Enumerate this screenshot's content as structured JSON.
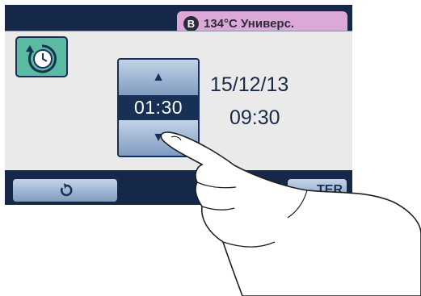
{
  "header": {
    "program_letter": "B",
    "program_label": "134°C Универс."
  },
  "timer": {
    "icon": "timer-clock-icon",
    "up_icon": "▲",
    "down_icon": "▼",
    "value": "01:30"
  },
  "datetime": {
    "date": "15/12/13",
    "time": "09:30"
  },
  "footer": {
    "back_icon": "back-arrow-icon",
    "enter_label": "TER"
  },
  "colors": {
    "frame": "#16284a",
    "panel": "#eaeaea",
    "badge": "#dca8d8",
    "timer_icon_bg": "#5bbba0",
    "button": "#9db4d2"
  },
  "overlay": {
    "icon": "pointing-hand-icon"
  }
}
